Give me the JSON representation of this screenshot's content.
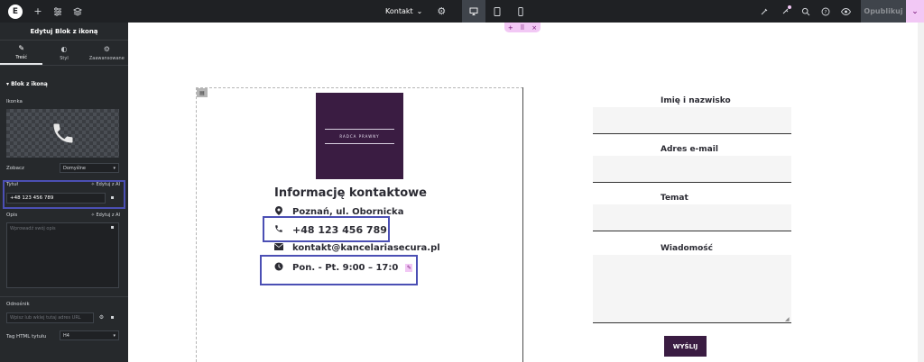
{
  "topbar": {
    "logo_letter": "E",
    "page_name": "Kontakt",
    "publish_label": "Opublikuj"
  },
  "panel": {
    "title": "Edytuj Blok z ikoną",
    "tabs": [
      {
        "label": "Treść",
        "icon": "pencil-icon"
      },
      {
        "label": "Styl",
        "icon": "contrast-icon"
      },
      {
        "label": "Zaawansowane",
        "icon": "gear-icon"
      }
    ],
    "section_title": "Blok z ikoną",
    "icon_label": "Ikonka",
    "view_label": "Zobacz",
    "view_value": "Domyślne",
    "title_label": "Tytuł",
    "ai_label": "Edytuj z AI",
    "title_value": "+48 123 456 789",
    "desc_label": "Opis",
    "desc_placeholder": "Wprowadź swój opis",
    "link_label": "Odnośnik",
    "link_placeholder": "Wpisz lub wklej tutaj adres URL",
    "html_tag_label": "Tag HTML tytułu",
    "html_tag_value": "H4"
  },
  "content": {
    "logo_text": "RADCA PRAWNY",
    "heading": "Informację kontaktowe",
    "items": [
      {
        "icon": "location-icon",
        "text": "Poznań, ul. Obornicka"
      },
      {
        "icon": "phone-icon",
        "text": "+48 123 456 789"
      },
      {
        "icon": "envelope-icon",
        "text": "kontakt@kancelariasecura.pl"
      },
      {
        "icon": "clock-icon",
        "text": "Pon. - Pt. 9:00 – 17:0"
      }
    ]
  },
  "form": {
    "name_label": "Imię i nazwisko",
    "email_label": "Adres e-mail",
    "subject_label": "Temat",
    "message_label": "Wiadomość",
    "submit_label": "WYŚLIJ"
  },
  "colors": {
    "brand_purple": "#3a1c42",
    "highlight_blue": "#4b4fb4",
    "editor_pink": "#f2c8f5"
  }
}
